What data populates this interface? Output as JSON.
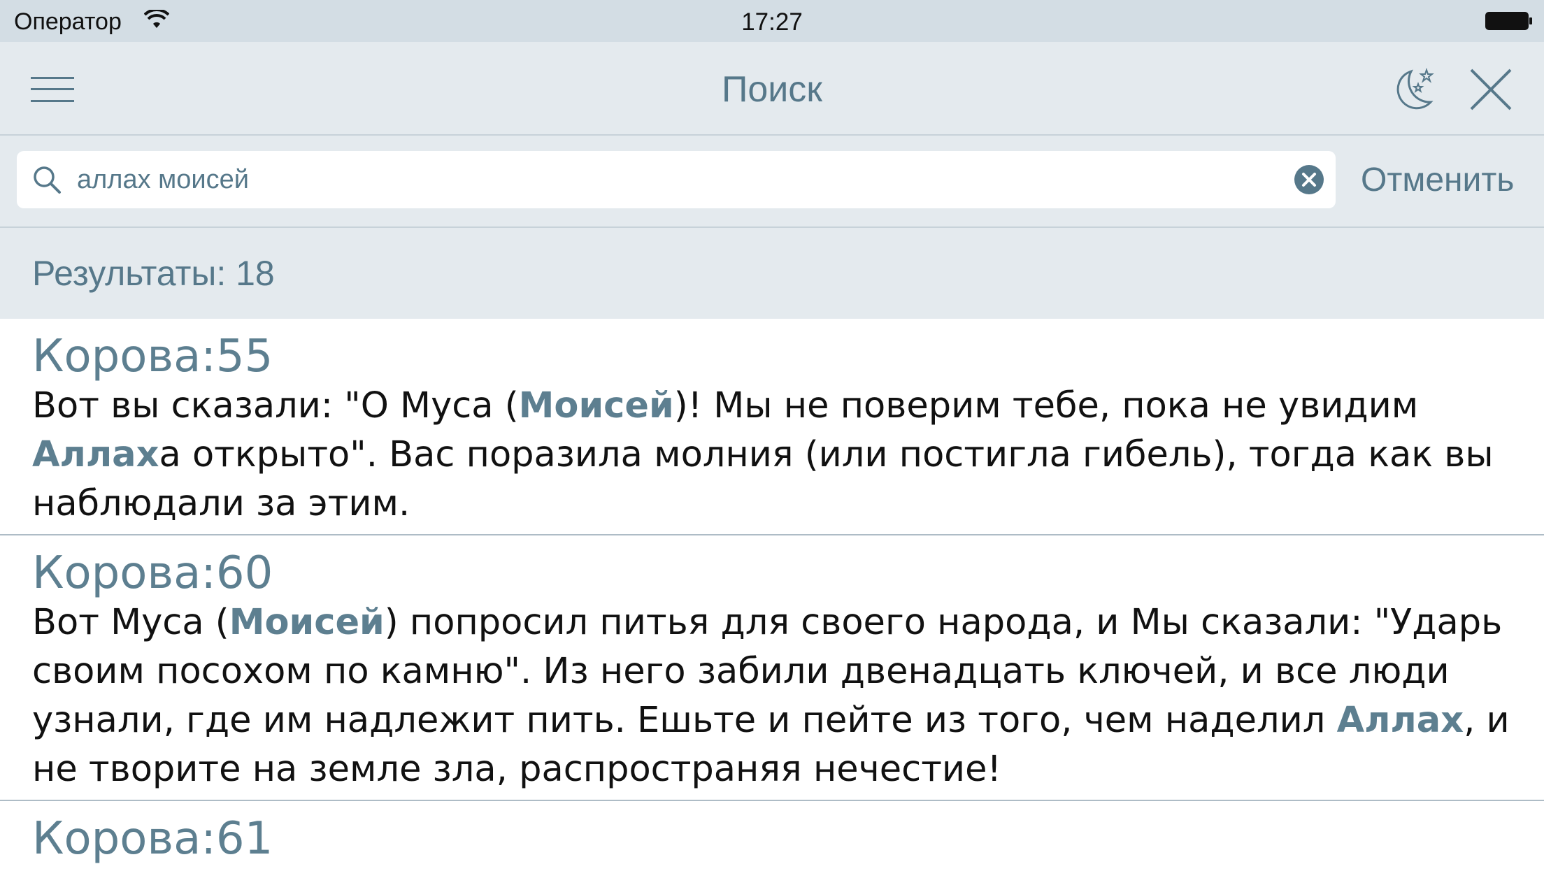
{
  "status_bar": {
    "carrier": "Оператор",
    "time": "17:27"
  },
  "nav": {
    "title": "Поиск",
    "icons": [
      "menu-icon",
      "night-mode-icon",
      "close-icon"
    ]
  },
  "search": {
    "query": "аллах моисей",
    "placeholder": "",
    "cancel_label": "Отменить"
  },
  "results": {
    "count_label": "Результаты: 18",
    "items": [
      {
        "ref": "Корова:55",
        "segments": [
          {
            "text": "Вот вы сказали: \"О Муса (",
            "hl": false
          },
          {
            "text": "Моисей",
            "hl": true
          },
          {
            "text": ")! Мы не поверим тебе, пока не увидим ",
            "hl": false
          },
          {
            "text": "Аллах",
            "hl": true
          },
          {
            "text": "а открыто\". Вас поразила молния (или постигла гибель), тогда как вы наблюдали за этим.",
            "hl": false
          }
        ]
      },
      {
        "ref": "Корова:60",
        "segments": [
          {
            "text": "Вот Муса (",
            "hl": false
          },
          {
            "text": "Моисей",
            "hl": true
          },
          {
            "text": ") попросил питья для своего народа, и Мы сказали: \"Ударь своим посохом по камню\". Из него забили двенадцать ключей, и все люди узнали, где им надлежит пить. Ешьте и пейте из того, чем наделил ",
            "hl": false
          },
          {
            "text": "Аллах",
            "hl": true
          },
          {
            "text": ", и не творите на земле зла, распространяя нечестие!",
            "hl": false
          }
        ]
      },
      {
        "ref": "Корова:61",
        "segments": []
      }
    ]
  },
  "colors": {
    "accent": "#56788a",
    "bar_background": "#e4eaee",
    "status_background": "#d3dde4"
  }
}
